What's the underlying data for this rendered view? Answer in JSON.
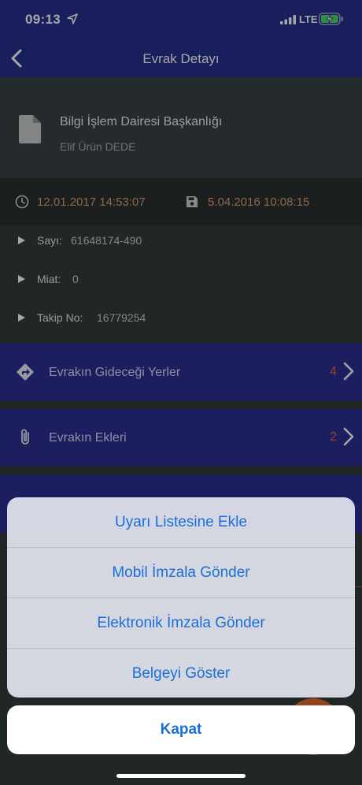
{
  "status_bar": {
    "time": "09:13",
    "network": "LTE"
  },
  "nav": {
    "title": "Evrak Detayı"
  },
  "document": {
    "title": "Bilgi İşlem Dairesi Başkanlığı",
    "owner": "Elif Ürün DEDE"
  },
  "dates": {
    "received": "12.01.2017 14:53:07",
    "saved": "5.04.2016 10:08:15"
  },
  "details": [
    {
      "label": "Sayı:",
      "value": "61648174-490"
    },
    {
      "label": "Miat:",
      "value": "0"
    },
    {
      "label": "Takip No:",
      "value": "16779254"
    }
  ],
  "sections": [
    {
      "label": "Evrakın Gideceği Yerler",
      "count": "4",
      "icon": "directions-icon"
    },
    {
      "label": "Evrakın Ekleri",
      "count": "2",
      "icon": "paperclip-icon"
    }
  ],
  "action_sheet": {
    "options": [
      "Uyarı Listesine Ekle",
      "Mobil İmzala Gönder",
      "Elektronik İmzala Gönder",
      "Belgeyi Göster"
    ],
    "cancel": "Kapat"
  },
  "colors": {
    "nav_bg": "#27308f",
    "accent_orange": "#e39a6e",
    "sheet_text": "#1c6fd6"
  }
}
